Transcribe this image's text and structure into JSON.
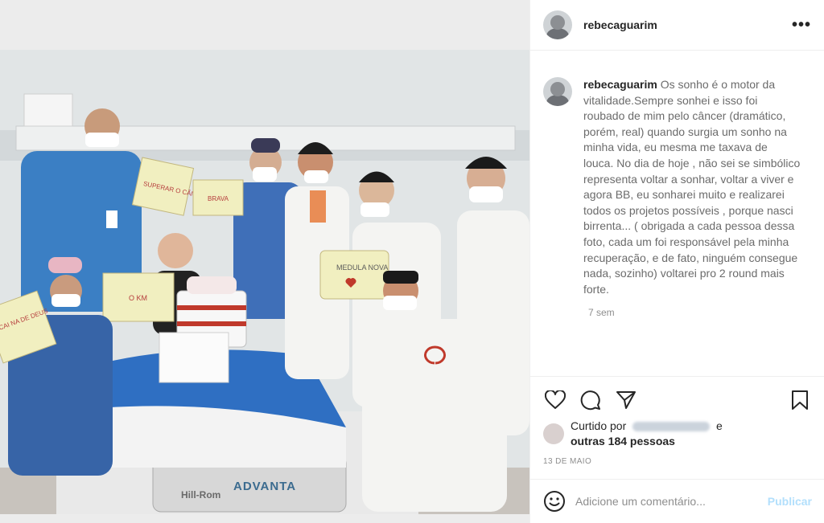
{
  "post": {
    "username": "rebecaguarim",
    "more_label": "•••",
    "caption": "Os sonho é o motor da vitalidade.Sempre sonhei e isso foi roubado de mim pelo câncer (dramático, porém, real) quando surgia um sonho na minha vida, eu mesma me taxava de louca. No dia de hoje , não sei se simbólico representa voltar a sonhar, voltar a viver e agora BB, eu sonharei muito e realizarei todos os projetos possíveis , porque nasci birrenta... ( obrigada a cada pessoa dessa foto, cada um foi responsável pela minha recuperação, e de fato, ninguém consegue nada, sozinho) voltarei pro 2 round mais forte.",
    "time_ago": "7 sem",
    "likes_prefix": "Curtido por",
    "likes_conjunction": "e",
    "likes_others": "outras 184 pessoas",
    "date": "13 DE MAIO"
  },
  "comment": {
    "placeholder": "Adicione um comentário...",
    "publish_label": "Publicar"
  },
  "photo": {
    "sign_left_top": "SUPERAR O CÂNCER",
    "sign_left_mid": "BRAVA",
    "sign_center": "O KM",
    "sign_right": "MEDULA NOVA",
    "sign_far_left": "CAI NA DE DEUS",
    "bed_brand": "Hill-Rom",
    "bed_model": "ADVANTA"
  },
  "icons": {
    "like": "heart-icon",
    "comment": "comment-icon",
    "share": "share-icon",
    "save": "bookmark-icon",
    "emoji": "emoji-icon"
  },
  "colors": {
    "scrubs_blue": "#3b7fc4",
    "coat_white": "#f4f4f2",
    "bed_blue": "#2f6fc2",
    "publish_disabled": "#b2dffc"
  }
}
